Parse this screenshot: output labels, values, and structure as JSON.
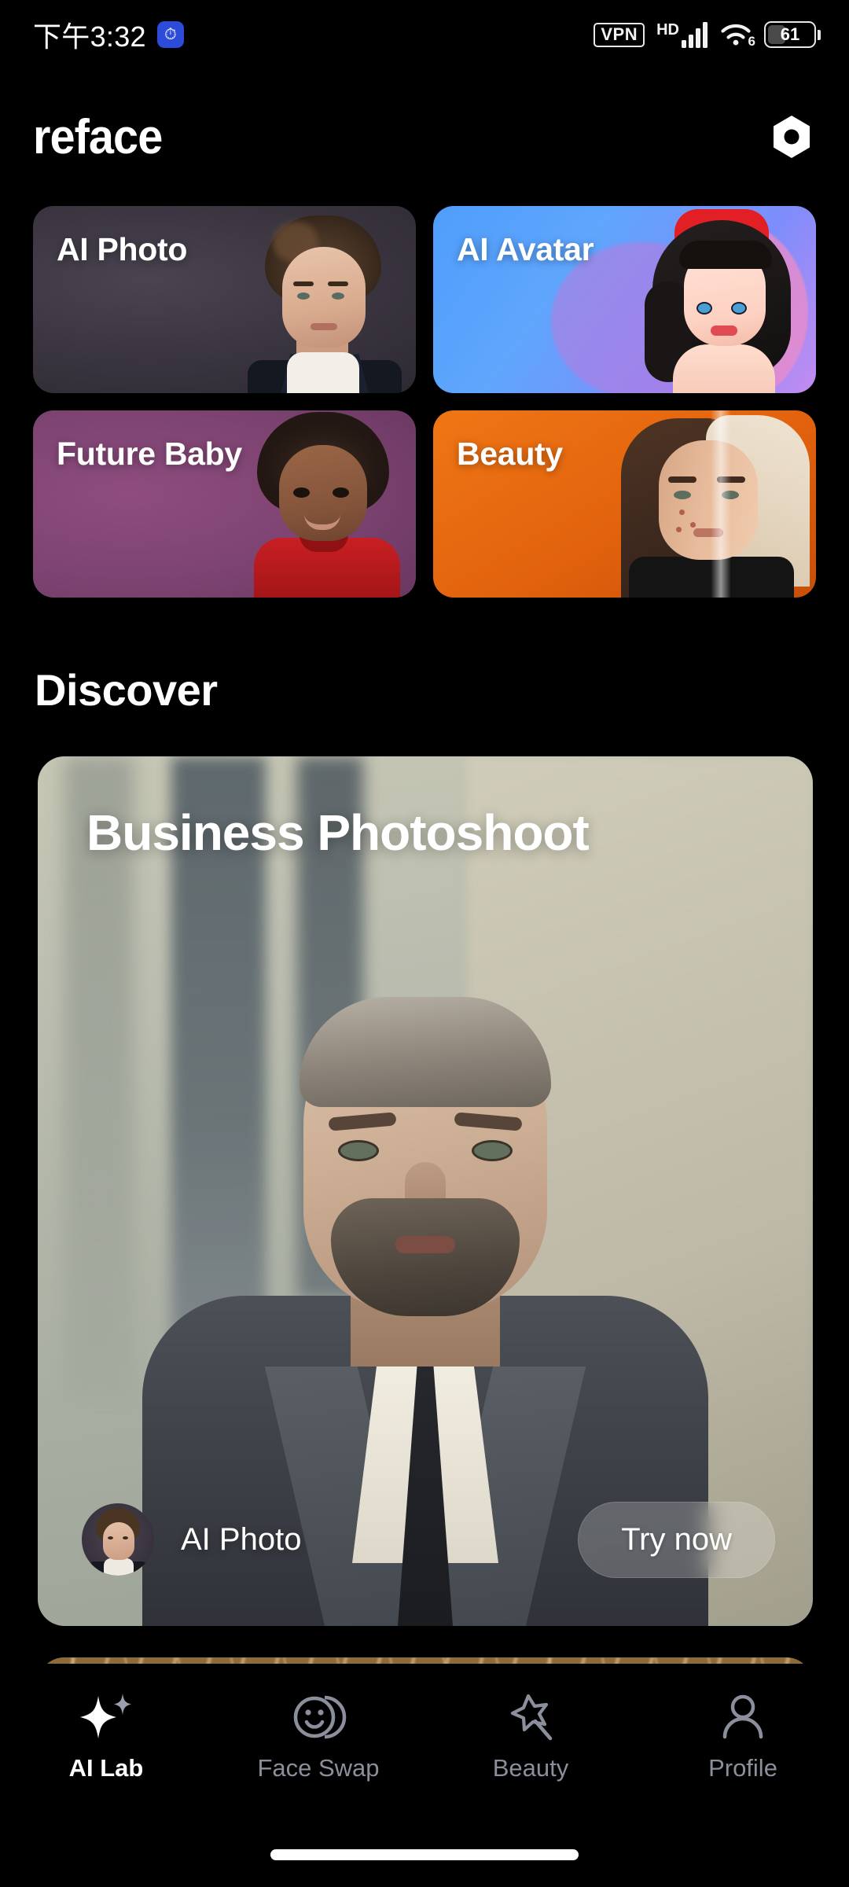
{
  "status_bar": {
    "time": "下午3:32",
    "app_icon": "alarm-icon",
    "vpn_label": "VPN",
    "network_label": "HD",
    "wifi_generation": "6",
    "battery_percent": "61"
  },
  "header": {
    "logo": "reface",
    "pro_icon": "hexagon-icon"
  },
  "feature_cards": [
    {
      "label": "AI Photo",
      "accent": "#3a3540"
    },
    {
      "label": "AI Avatar",
      "accent": "#5fa6fd"
    },
    {
      "label": "Future Baby",
      "accent": "#7b4270"
    },
    {
      "label": "Beauty",
      "accent": "#e2620d"
    }
  ],
  "discover": {
    "section_title": "Discover",
    "hero": {
      "title": "Business Photoshoot",
      "category": "AI Photo",
      "cta_label": "Try now",
      "avatar_icon": "ai-photo-avatar"
    }
  },
  "bottom_nav": {
    "items": [
      {
        "label": "AI Lab",
        "icon": "sparkle-icon",
        "active": true
      },
      {
        "label": "Face Swap",
        "icon": "faces-icon",
        "active": false
      },
      {
        "label": "Beauty",
        "icon": "magic-wand-icon",
        "active": false
      },
      {
        "label": "Profile",
        "icon": "person-icon",
        "active": false
      }
    ],
    "active_color": "#ffffff",
    "inactive_color": "#8b8f9c"
  }
}
